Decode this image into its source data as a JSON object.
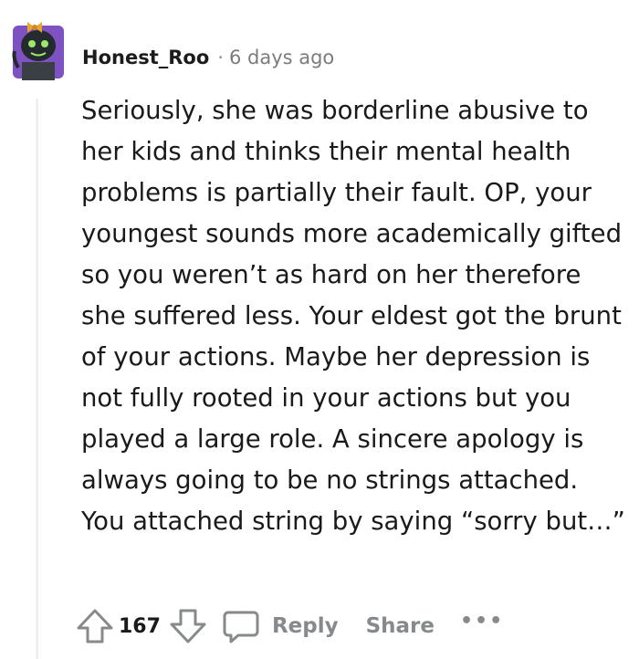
{
  "comment": {
    "username": "Honest_Roo",
    "separator": "·",
    "time_ago": "6 days ago",
    "body": "Seriously, she was borderline abusive to her kids and thinks their mental health problems is partially their fault. OP, your youngest sounds more academically gifted so you weren’t as hard on her therefore she suffered less. Your eldest got the brunt of your actions. Maybe her depression is not fully rooted in your actions but you played a large role. A sincere apology is always going to be no strings attached. You attached string by saying “sorry but…”",
    "avatar_icon": "snoo-avatar-icon"
  },
  "actions": {
    "upvote_icon": "upvote-arrow-icon",
    "vote_count": "167",
    "downvote_icon": "downvote-arrow-icon",
    "reply_icon": "speech-bubble-icon",
    "reply_label": "Reply",
    "share_label": "Share",
    "more_label": "•••"
  },
  "colors": {
    "text": "#1a1a1b",
    "muted": "#878a8c",
    "thread_line": "#edeff1",
    "avatar_bg": "#7e53c1"
  }
}
